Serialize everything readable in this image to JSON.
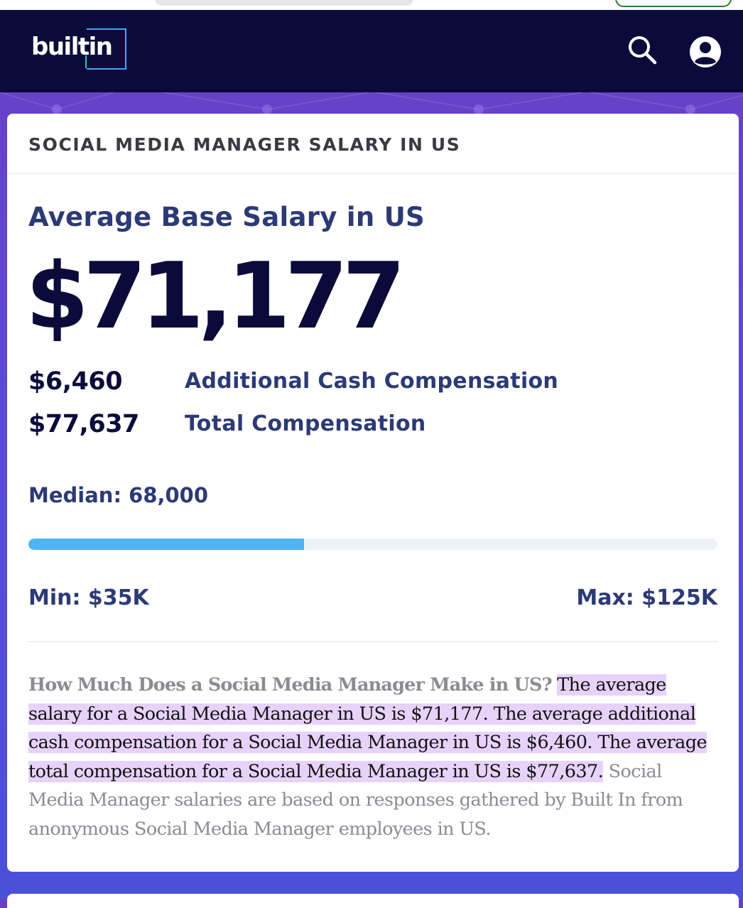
{
  "navbar": {
    "logo_text": "builtin",
    "search_icon": "search-icon",
    "user_icon": "user-account-icon"
  },
  "card": {
    "title": "SOCIAL MEDIA MANAGER SALARY IN US",
    "avg_label": "Average Base Salary in US",
    "avg_value": "$71,177",
    "compensation": [
      {
        "amount": "$6,460",
        "label": "Additional Cash Compensation"
      },
      {
        "amount": "$77,637",
        "label": "Total Compensation"
      }
    ],
    "median": "Median: 68,000",
    "range": {
      "min_label": "Min: $35K",
      "max_label": "Max: $125K",
      "fill_fraction": 0.4
    },
    "description": {
      "question": "How Much Does a Social Media Manager Make in US?",
      "highlight": "The average salary for a Social Media Manager in US is $71,177. The average additional cash compensation for a Social Media Manager in US is $6,460. The average total compensation for a Social Media Manager in US is $77,637.",
      "rest": "Social Media Manager salaries are based on responses gathered by Built In from anonymous Social Media Manager employees in US."
    }
  },
  "colors": {
    "navbar_bg": "#0b0b3b",
    "accent_blue": "#50b3f2",
    "heading_navy": "#2c3a75",
    "highlight": "#e7d2fa",
    "page_bg": "#5a4bd6"
  }
}
